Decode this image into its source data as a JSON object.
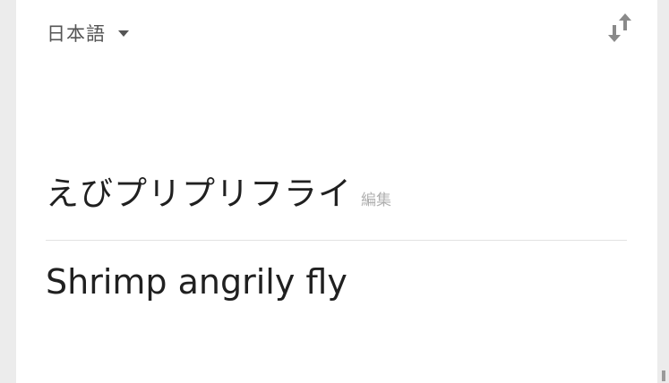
{
  "language_selector": {
    "label": "日本語",
    "icon": "dropdown-arrow"
  },
  "swap": {
    "icon": "swap-vertical-arrows"
  },
  "source": {
    "text": "えびプリプリフライ",
    "edit_label": "編集"
  },
  "translation": {
    "text": "Shrimp angrily fly"
  },
  "colors": {
    "background": "#ececec",
    "card": "#ffffff",
    "text_primary": "#202020",
    "text_secondary": "#555555",
    "text_muted": "#b0b0b0"
  }
}
